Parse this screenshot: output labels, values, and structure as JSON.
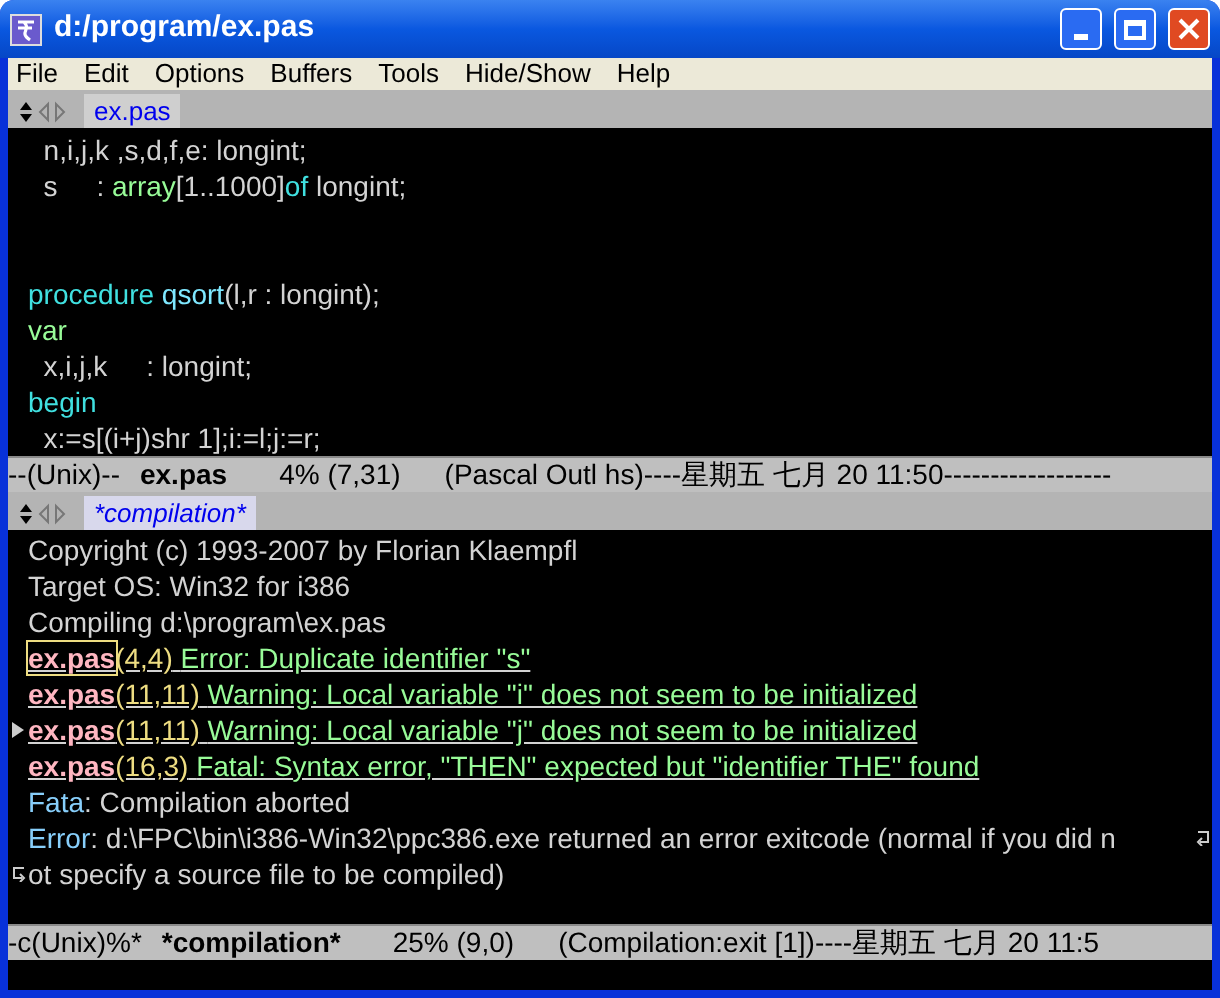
{
  "window": {
    "title": "d:/program/ex.pas"
  },
  "menu": [
    "File",
    "Edit",
    "Options",
    "Buffers",
    "Tools",
    "Hide/Show",
    "Help"
  ],
  "editor": {
    "tab": {
      "label": "ex.pas",
      "selected": false
    },
    "lines": [
      {
        "kind": "code",
        "tokens": [
          {
            "text": "  n,i,j,k ,s,d,f,e: longint;",
            "kind": "plain"
          }
        ]
      },
      {
        "kind": "code",
        "tokens": [
          {
            "text": "  s     : ",
            "kind": "plain"
          },
          {
            "text": "array",
            "kind": "builtin"
          },
          {
            "text": "[1..1000]",
            "kind": "plain"
          },
          {
            "text": "of",
            "kind": "keyword"
          },
          {
            "text": " longint;",
            "kind": "plain"
          }
        ]
      },
      {
        "kind": "blank"
      },
      {
        "kind": "blank"
      },
      {
        "kind": "code",
        "tokens": [
          {
            "text": "procedure",
            "kind": "keyword"
          },
          {
            "text": " qsort",
            "kind": "function"
          },
          {
            "text": "(l,r : longint);",
            "kind": "plain"
          }
        ]
      },
      {
        "kind": "code",
        "tokens": [
          {
            "text": "var",
            "kind": "builtin"
          }
        ]
      },
      {
        "kind": "code",
        "tokens": [
          {
            "text": "  x,i,j,k     : longint;",
            "kind": "plain"
          }
        ]
      },
      {
        "kind": "code",
        "tokens": [
          {
            "text": "begin",
            "kind": "keyword"
          }
        ]
      },
      {
        "kind": "code",
        "tokens": [
          {
            "text": "  x:=s[(i+j)shr 1];i:=l;j:=r;",
            "kind": "plain"
          }
        ]
      }
    ],
    "mode_line": [
      {
        "text": "--(Unix)--",
        "bold": false
      },
      {
        "text": "ex.pas",
        "bold": true
      },
      {
        "text": "4% (7,31)",
        "bold": false
      },
      {
        "text": "(Pascal Outl hs)----星期五 七月 20 11:50------------------",
        "bold": false
      }
    ]
  },
  "compilation": {
    "tab": {
      "label": "*compilation*",
      "selected": true
    },
    "lines": [
      {
        "kind": "plain",
        "text": "Copyright (c) 1993-2007 by Florian Klaempfl"
      },
      {
        "kind": "plain",
        "text": "Target OS: Win32 for i386"
      },
      {
        "kind": "plain",
        "text": "Compiling d:\\program\\ex.pas"
      },
      {
        "kind": "error",
        "file": "ex.pas",
        "location": "(4,4)",
        "message": "Error: Duplicate identifier \"s\"",
        "cursor": true,
        "arrow": false
      },
      {
        "kind": "error",
        "file": "ex.pas",
        "location": "(11,11)",
        "message": "Warning: Local variable \"i\" does not seem to be initialized",
        "cursor": false,
        "arrow": false
      },
      {
        "kind": "error",
        "file": "ex.pas",
        "location": "(11,11)",
        "message": "Warning: Local variable \"j\" does not seem to be initialized",
        "cursor": false,
        "arrow": true
      },
      {
        "kind": "error",
        "file": "ex.pas",
        "location": "(16,3)",
        "message": "Fatal: Syntax error, \"THEN\" expected but \"identifier THE\" found",
        "cursor": false,
        "arrow": false
      },
      {
        "kind": "prefixed",
        "prefix": "Fata",
        "text": ": Compilation aborted"
      },
      {
        "kind": "prefixed",
        "prefix": "Error",
        "text": ": d:\\FPC\\bin\\i386-Win32\\ppc386.exe returned an error exitcode (normal if you did n",
        "continuation": "ot specify a source file to be compiled)"
      }
    ],
    "mode_line": [
      {
        "text": "-c(Unix)%*",
        "bold": false
      },
      {
        "text": "*compilation*",
        "bold": true
      },
      {
        "text": "25% (9,0)",
        "bold": false
      },
      {
        "text": "(Compilation:exit [1])----星期五 七月 20 11:5",
        "bold": false
      }
    ]
  }
}
